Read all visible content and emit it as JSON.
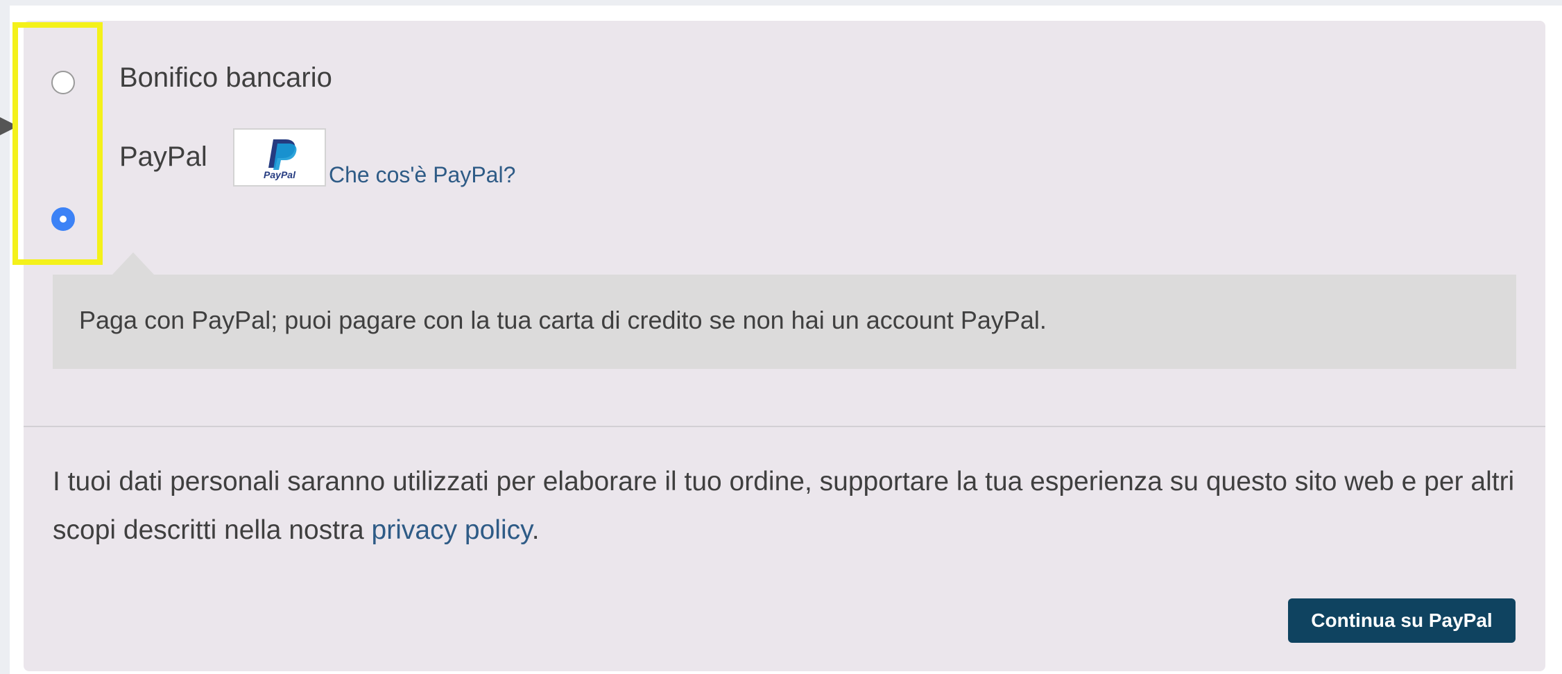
{
  "payment_methods": [
    {
      "label": "Bonifico bancario",
      "selected": false
    },
    {
      "label": "PayPal",
      "selected": true,
      "logo_text": "PayPal",
      "info_link": "Che cos'è PayPal?"
    }
  ],
  "paypal_description": "Paga con PayPal; puoi pagare con la tua carta di credito se non hai un account PayPal.",
  "privacy_notice": {
    "text_before": "I tuoi dati personali saranno utilizzati per elaborare il tuo ordine, supportare la tua esperienza su questo sito web e per altri scopi descritti nella nostra ",
    "link_text": "privacy policy",
    "text_after": "."
  },
  "continue_button": "Continua su PayPal",
  "colors": {
    "panel_bg": "#ebe6ec",
    "callout_bg": "#dcdbdb",
    "link": "#2e5b86",
    "button_bg": "#0f4360",
    "radio_checked": "#3c82f6",
    "highlight": "#f4f11a",
    "paypal_dark_blue": "#253b80",
    "paypal_light_blue": "#179bd7"
  },
  "icons": {
    "cursor_marker": "arrow-pointer-icon",
    "paypal": "paypal-logo-icon"
  }
}
